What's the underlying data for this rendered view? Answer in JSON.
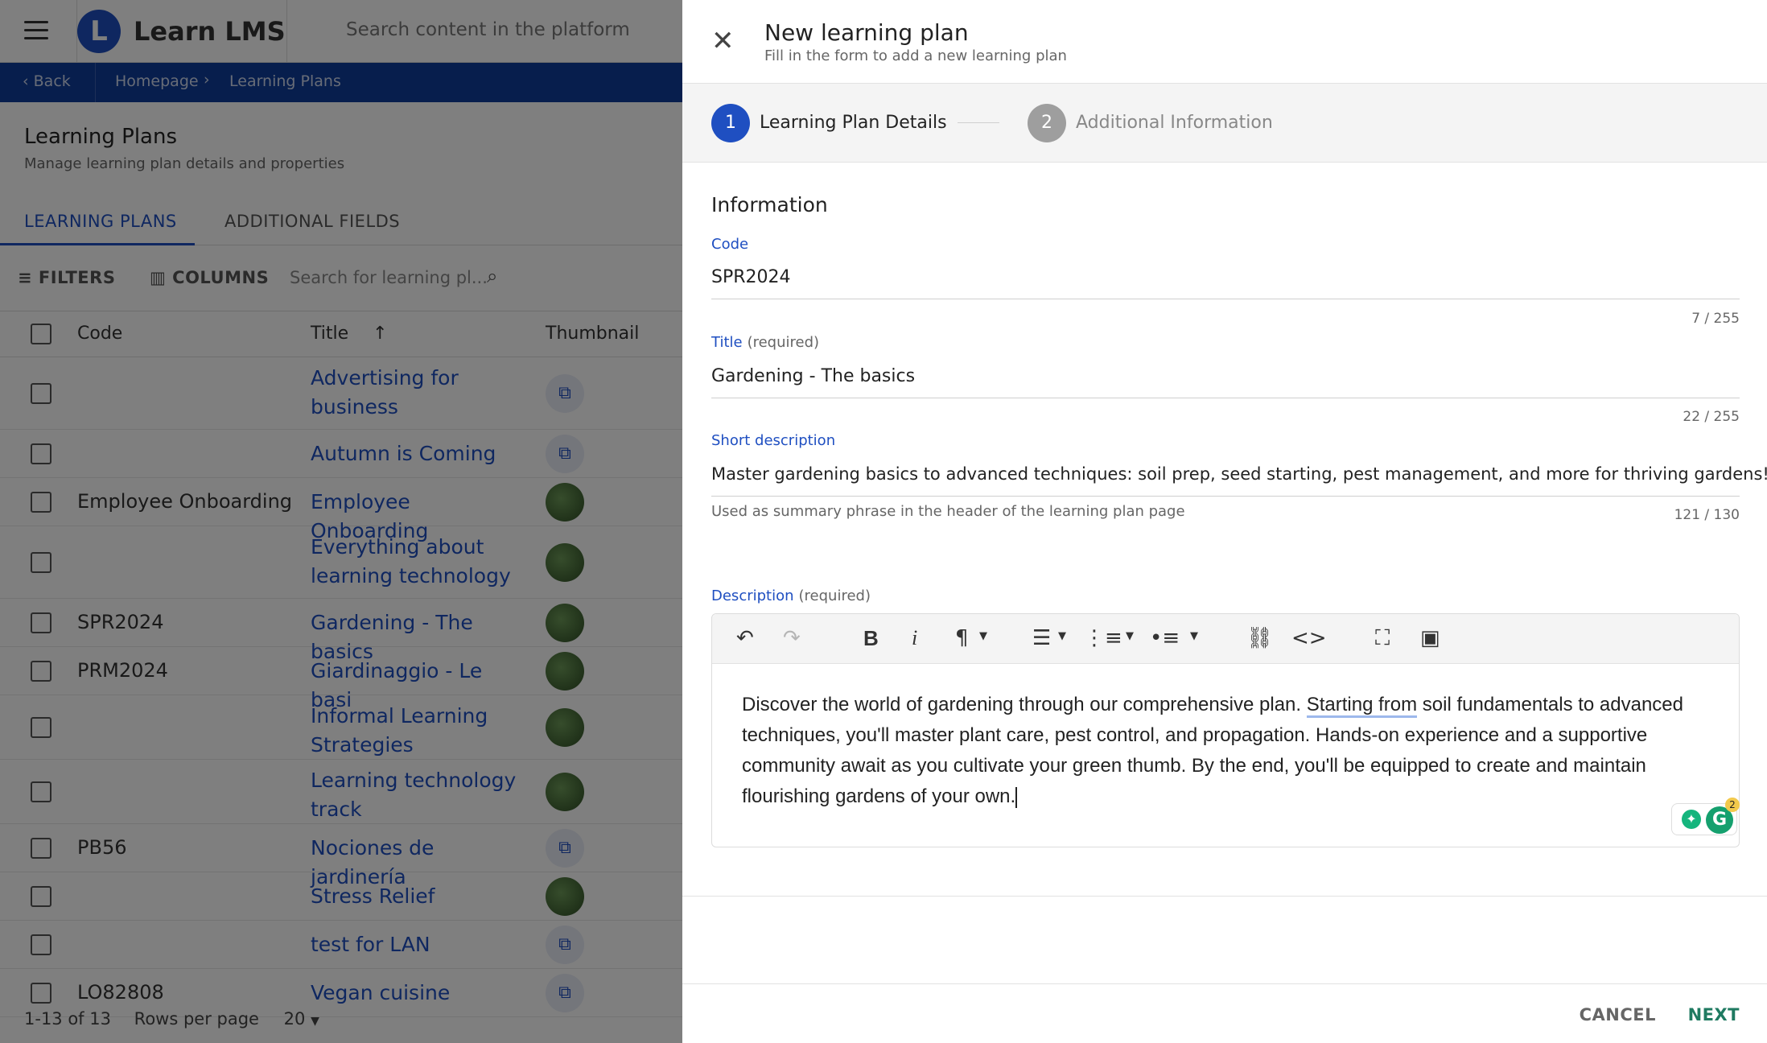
{
  "app": {
    "logo_letter": "L",
    "logo_text": "Learn LMS",
    "search_placeholder": "Search content in the platform"
  },
  "breadcrumb": {
    "back": "Back",
    "home": "Homepage",
    "current": "Learning Plans"
  },
  "page": {
    "title": "Learning Plans",
    "subtitle": "Manage learning plan details and properties"
  },
  "tabs": [
    "LEARNING PLANS",
    "ADDITIONAL FIELDS"
  ],
  "toolbar": {
    "filters": "FILTERS",
    "columns": "COLUMNS",
    "search_placeholder": "Search for learning pl..."
  },
  "table": {
    "headers": {
      "code": "Code",
      "title": "Title",
      "thumbnail": "Thumbnail"
    },
    "rows": [
      {
        "code": "",
        "title": "Advertising for business",
        "thumb": "icon"
      },
      {
        "code": "",
        "title": "Autumn is Coming",
        "thumb": "icon"
      },
      {
        "code": "Employee Onboarding",
        "title": "Employee Onboarding",
        "thumb": "photo"
      },
      {
        "code": "",
        "title": "Everything about learning technology",
        "thumb": "photo"
      },
      {
        "code": "SPR2024",
        "title": "Gardening - The basics",
        "thumb": "photo"
      },
      {
        "code": "PRM2024",
        "title": "Giardinaggio - Le basi",
        "thumb": "photo"
      },
      {
        "code": "",
        "title": "Informal Learning Strategies",
        "thumb": "photo"
      },
      {
        "code": "",
        "title": "Learning technology track",
        "thumb": "photo"
      },
      {
        "code": "PB56",
        "title": "Nociones de jardinería",
        "thumb": "icon"
      },
      {
        "code": "",
        "title": "Stress Relief",
        "thumb": "photo"
      },
      {
        "code": "",
        "title": "test for LAN",
        "thumb": "icon"
      },
      {
        "code": "LO82808",
        "title": "Vegan cuisine",
        "thumb": "icon"
      }
    ]
  },
  "pagination": {
    "range": "1-13 of 13",
    "rows_per_page_label": "Rows per page",
    "rows_per_page": "20"
  },
  "drawer": {
    "close_icon": "close-icon",
    "title": "New learning plan",
    "subtitle": "Fill in the form to add a new learning plan",
    "steps": [
      {
        "number": "1",
        "label": "Learning Plan Details",
        "state": "active"
      },
      {
        "number": "2",
        "label": "Additional Information",
        "state": "inactive"
      }
    ],
    "section_title": "Information",
    "fields": {
      "code": {
        "label": "Code",
        "value": "SPR2024",
        "counter": "7 / 255"
      },
      "title": {
        "label": "Title",
        "required": "(required)",
        "value": "Gardening - The basics",
        "counter": "22 / 255"
      },
      "short_description": {
        "label": "Short description",
        "value": "Master gardening basics to advanced techniques: soil prep, seed starting, pest management, and more for thriving gardens!",
        "helper": "Used as summary phrase in the header of the learning plan page",
        "counter": "121 / 130"
      },
      "description": {
        "label": "Description",
        "required": "(required)",
        "text_before": "Discover the world of gardening through our comprehensive plan. ",
        "text_marked": "Starting from",
        "text_after": " soil fundamentals to advanced techniques, you'll master plant care, pest control, and propagation. Hands-on experience and a supportive community await as you cultivate your green thumb. By the end, you'll be equipped to create and maintain flourishing gardens of your own."
      }
    },
    "grammarly_badge": "2",
    "cancel": "CANCEL",
    "next": "NEXT"
  },
  "colors": {
    "primary": "#1f4fc1",
    "breadcrumb_bg": "#0f3c9a",
    "next_button": "#1f7a61",
    "step_inactive": "#9e9e9e"
  }
}
